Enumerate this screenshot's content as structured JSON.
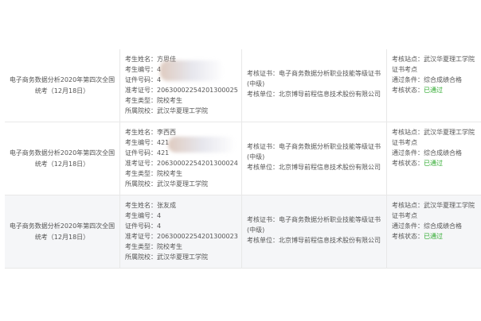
{
  "rows": [
    {
      "exam_lines": [
        "电子商务数据分析2020年第四次全国",
        "统考（12月18日）"
      ],
      "candidate": {
        "name": "考生姓名：方思佳",
        "number": "考生编号：4",
        "id_number": "证件号码：4",
        "admission": "准考证号：20630002254201300025",
        "type": "考生类型：院校考生",
        "school": "所属院校：武汉华夏理工学院"
      },
      "certificate_lines": [
        "考核证书：电子商务数据分析职业技能等级证书",
        "(中级)"
      ],
      "unit": "考核单位：北京博导前程信息技术股份有限公司",
      "site_lines": [
        "考核站点：武汉华夏理工学院",
        "证书考点"
      ],
      "condition": "通过条件：综合成绩合格",
      "status_label": "考核状态：",
      "status_value": "已通过"
    },
    {
      "exam_lines": [
        "电子商务数据分析2020年第四次全国",
        "统考（12月18日）"
      ],
      "candidate": {
        "name": "考生姓名：李西西",
        "number": "考生编号：421",
        "id_number": "证件号码：421",
        "admission": "准考证号：20630002254201300024",
        "type": "考生类型：院校考生",
        "school": "所属院校：武汉华夏理工学院"
      },
      "certificate_lines": [
        "考核证书：电子商务数据分析职业技能等级证书",
        "(中级)"
      ],
      "unit": "考核单位：北京博导前程信息技术股份有限公司",
      "site_lines": [
        "考核站点：武汉华夏理工学院",
        "证书考点"
      ],
      "condition": "通过条件：综合成绩合格",
      "status_label": "考核状态：",
      "status_value": "已通过"
    },
    {
      "exam_lines": [
        "电子商务数据分析2020年第四次全国",
        "统考（12月18日）"
      ],
      "candidate": {
        "name": "考生姓名：张友成",
        "number": "考生编号：4",
        "id_number": "证件号码：4",
        "admission": "准考证号：20630002254201300023",
        "type": "考生类型：院校考生",
        "school": "所属院校：武汉华夏理工学院"
      },
      "certificate_lines": [
        "考核证书：电子商务数据分析职业技能等级证书",
        "(中级)"
      ],
      "unit": "考核单位：北京博导前程信息技术股份有限公司",
      "site_lines": [
        "考核站点：武汉华夏理工学院",
        "证书考点"
      ],
      "condition": "通过条件：综合成绩合格",
      "status_label": "考核状态：",
      "status_value": "已通过"
    }
  ]
}
